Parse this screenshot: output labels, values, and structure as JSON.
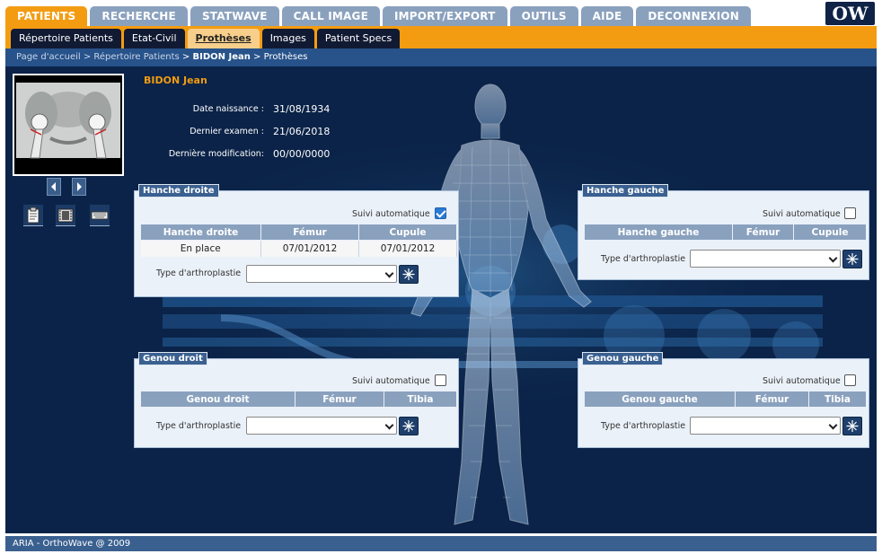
{
  "topnav": {
    "tabs": [
      "PATIENTS",
      "RECHERCHE",
      "STATWAVE",
      "CALL IMAGE",
      "IMPORT/EXPORT",
      "OUTILS",
      "AIDE",
      "DECONNEXION"
    ],
    "active": "PATIENTS",
    "logo_text": "OW"
  },
  "subnav": {
    "tabs": [
      "Répertoire Patients",
      "Etat-Civil",
      "Prothèses",
      "Images",
      "Patient Specs"
    ],
    "active": "Prothèses"
  },
  "breadcrumb": {
    "home": "Page d'accueil",
    "sep1": " > ",
    "directory": "Répertoire Patients",
    "sep2": " > ",
    "patient": "BIDON Jean",
    "sep3": " > ",
    "page": "Prothèses"
  },
  "patient": {
    "name": "BIDON Jean",
    "birth_label": "Date naissance :",
    "birth_value": "31/08/1934",
    "last_exam_label": "Dernier examen :",
    "last_exam_value": "21/06/2018",
    "last_mod_label": "Dernière modification:",
    "last_mod_value": "00/00/0000"
  },
  "panels": {
    "hanche_droite": {
      "title": "Hanche droite",
      "suivi_label": "Suivi automatique",
      "suivi_checked": true,
      "headers": [
        "Hanche droite",
        "Fémur",
        "Cupule"
      ],
      "rows": [
        [
          "En place",
          "07/01/2012",
          "07/01/2012"
        ]
      ],
      "type_label": "Type d'arthroplastie",
      "type_value": ""
    },
    "hanche_gauche": {
      "title": "Hanche gauche",
      "suivi_label": "Suivi automatique",
      "suivi_checked": false,
      "headers": [
        "Hanche gauche",
        "Fémur",
        "Cupule"
      ],
      "type_label": "Type d'arthroplastie",
      "type_value": ""
    },
    "genou_droit": {
      "title": "Genou droit",
      "suivi_label": "Suivi automatique",
      "suivi_checked": false,
      "headers": [
        "Genou droit",
        "Fémur",
        "Tibia"
      ],
      "type_label": "Type d'arthroplastie",
      "type_value": ""
    },
    "genou_gauche": {
      "title": "Genou gauche",
      "suivi_label": "Suivi automatique",
      "suivi_checked": false,
      "headers": [
        "Genou gauche",
        "Fémur",
        "Tibia"
      ],
      "type_label": "Type d'arthroplastie",
      "type_value": ""
    }
  },
  "footer": {
    "text": "ARIA - OrthoWave @ 2009"
  },
  "colors": {
    "accent_orange": "#f39c12",
    "tab_inactive": "#8aa1be",
    "main_background": "#0b2348",
    "panel_background": "#eaf1f9"
  },
  "icons": {
    "prev": "triangle-left-icon",
    "next": "triangle-right-icon",
    "tools": [
      "clipboard-icon",
      "film-icon",
      "keyboard-icon"
    ],
    "go": "sparkle-icon"
  }
}
